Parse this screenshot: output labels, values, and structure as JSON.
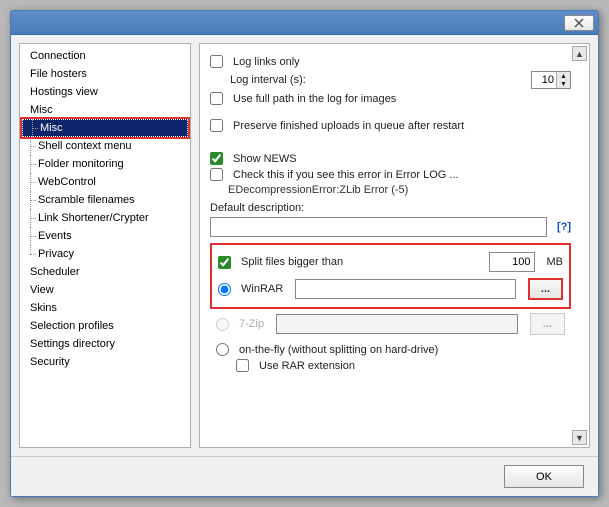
{
  "tree": {
    "items": [
      "Connection",
      "File hosters",
      "Hostings view",
      "Misc",
      "Misc",
      "Shell context menu",
      "Folder monitoring",
      "WebControl",
      "Scramble filenames",
      "Link Shortener/Crypter",
      "Events",
      "Privacy",
      "Scheduler",
      "View",
      "Skins",
      "Selection profiles",
      "Settings directory",
      "Security"
    ]
  },
  "panel": {
    "log_links_only": "Log links only",
    "log_interval_label": "Log interval (s):",
    "log_interval_value": "10",
    "use_full_path": "Use full path in the log for images",
    "preserve_queue": "Preserve finished uploads in queue after restart",
    "show_news": "Show NEWS",
    "check_error": "Check this if you see this error in Error LOG ...",
    "check_error_sub": "EDecompressionError:ZLib Error (-5)",
    "default_desc_label": "Default description:",
    "default_desc_value": "",
    "qmark": "[?]",
    "split_label": "Split files bigger than",
    "split_value": "100",
    "split_unit": "MB",
    "winrar": "WinRAR",
    "winrar_path": "",
    "sevenzip": "7-Zip",
    "sevenzip_path": "",
    "browse": "...",
    "onthefly": "on-the-fly (without splitting on hard-drive)",
    "use_rar_ext": "Use RAR extension"
  },
  "footer": {
    "ok": "OK"
  }
}
